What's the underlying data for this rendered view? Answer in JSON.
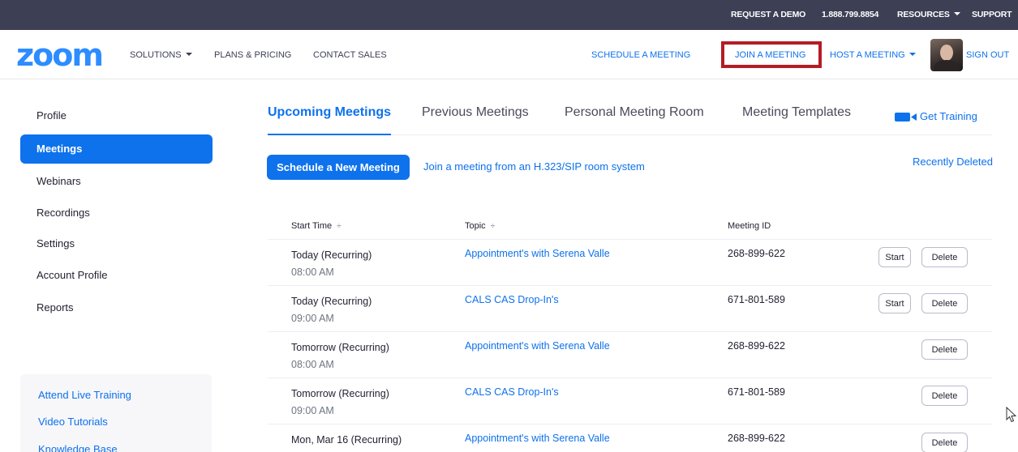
{
  "topbar": {
    "request_demo": "REQUEST A DEMO",
    "phone": "1.888.799.8854",
    "resources": "RESOURCES",
    "support": "SUPPORT"
  },
  "nav": {
    "logo": "zoom",
    "solutions": "SOLUTIONS",
    "plans": "PLANS & PRICING",
    "contact_sales": "CONTACT SALES",
    "schedule": "SCHEDULE A MEETING",
    "join": "JOIN A MEETING",
    "host": "HOST A MEETING",
    "sign_out": "SIGN OUT"
  },
  "sidebar": {
    "items": [
      {
        "label": "Profile",
        "active": false
      },
      {
        "label": "Meetings",
        "active": true
      },
      {
        "label": "Webinars",
        "active": false
      },
      {
        "label": "Recordings",
        "active": false
      },
      {
        "label": "Settings",
        "active": false
      },
      {
        "label": "Account Profile",
        "active": false
      },
      {
        "label": "Reports",
        "active": false
      }
    ],
    "links": [
      "Attend Live Training",
      "Video Tutorials",
      "Knowledge Base"
    ]
  },
  "tabs": [
    "Upcoming Meetings",
    "Previous Meetings",
    "Personal Meeting Room",
    "Meeting Templates"
  ],
  "get_training": "Get Training",
  "actions": {
    "schedule_new": "Schedule a New Meeting",
    "join_sip": "Join a meeting from an H.323/SIP room system",
    "recently_deleted": "Recently Deleted"
  },
  "table": {
    "headers": {
      "start_time": "Start Time",
      "topic": "Topic",
      "meeting_id": "Meeting ID"
    },
    "sort_glyph": "÷",
    "start_label": "Start",
    "delete_label": "Delete",
    "rows": [
      {
        "day": "Today (Recurring)",
        "time": "08:00 AM",
        "topic": "Appointment's with Serena Valle",
        "id": "268-899-622"
      },
      {
        "day": "Today (Recurring)",
        "time": "09:00 AM",
        "topic": "CALS CAS Drop-In's",
        "id": "671-801-589"
      },
      {
        "day": "Tomorrow (Recurring)",
        "time": "08:00 AM",
        "topic": "Appointment's with Serena Valle",
        "id": "268-899-622"
      },
      {
        "day": "Tomorrow (Recurring)",
        "time": "09:00 AM",
        "topic": "CALS CAS Drop-In's",
        "id": "671-801-589"
      },
      {
        "day": "Mon, Mar 16 (Recurring)",
        "time": "",
        "topic": "Appointment's with Serena Valle",
        "id": "268-899-622"
      }
    ]
  },
  "colors": {
    "topbar": "#3d3f55",
    "brand_blue": "#2d8cff",
    "accent_blue": "#0e72ed",
    "link_blue": "#0e71eb",
    "highlight_red": "#b41c24"
  }
}
